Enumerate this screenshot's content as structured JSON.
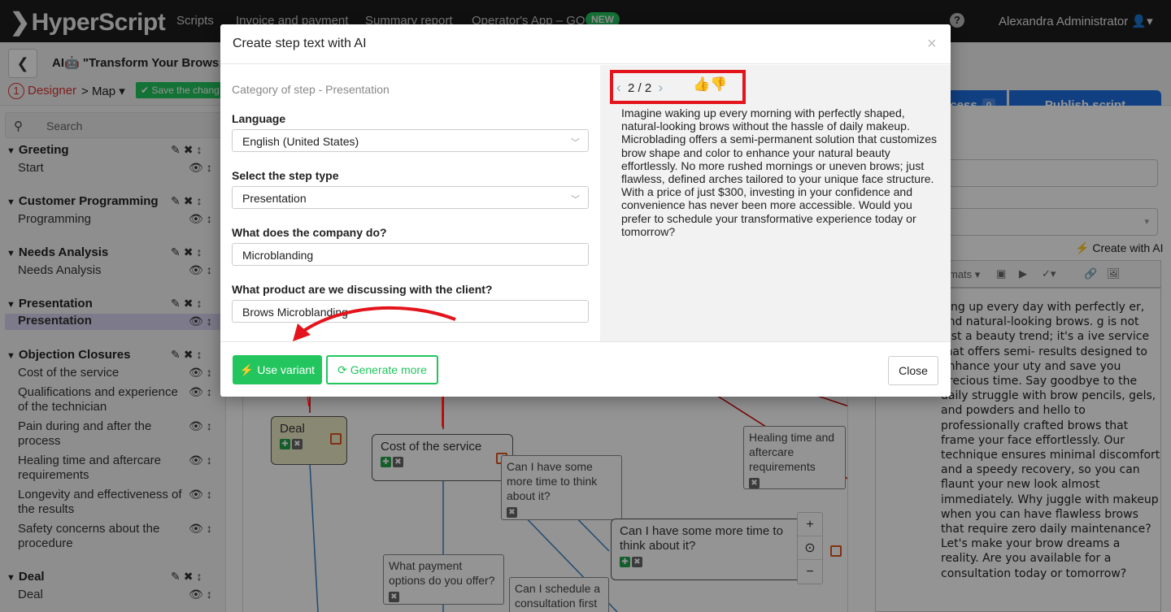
{
  "topbar": {
    "logo": "HyperScript",
    "nav": [
      "Scripts",
      "Invoice and payment",
      "Summary report",
      "Operator's App – GO"
    ],
    "new_badge": "NEW",
    "user": "Alexandra Administrator"
  },
  "subbar": {
    "script_name": "AI🤖 \"Transform Your Brows: D",
    "designer": "Designer",
    "designer_num": "1",
    "map": "Map",
    "save": "Save the chang",
    "access": "ccess",
    "access_count": "0",
    "publish": "Publish script"
  },
  "sidebar": {
    "search_placeholder": "Search",
    "groups": [
      {
        "title": "Greeting",
        "items": [
          "Start"
        ]
      },
      {
        "title": "Customer Programming",
        "items": [
          "Programming"
        ]
      },
      {
        "title": "Needs Analysis",
        "items": [
          "Needs Analysis"
        ]
      },
      {
        "title": "Presentation",
        "items": [
          "Presentation"
        ]
      },
      {
        "title": "Objection Closures",
        "items": [
          "Cost of the service",
          "Qualifications and experience of the technician",
          "Pain during and after the process",
          "Healing time and aftercare requirements",
          "Longevity and effectiveness of the results",
          "Safety concerns about the procedure"
        ]
      },
      {
        "title": "Deal",
        "items": [
          "Deal"
        ]
      }
    ]
  },
  "canvas": {
    "nodes": [
      "Deal",
      "Cost of the service",
      "Can I have some more time to think about it?",
      "Healing time and aftercare requirements",
      "Can I have some more time to think about it?",
      "What payment options do you offer?",
      "Can I schedule a consultation first to"
    ]
  },
  "right": {
    "create_ai": "Create with AI",
    "toolbar_formats": "mats",
    "editor_text": "king up every day with perfectly er, and natural-looking brows. g is not just a beauty trend; it's a ive service that offers semi- results designed to enhance your uty and save you precious time. Say goodbye to the daily struggle with brow pencils, gels, and powders and hello to professionally crafted brows that frame your face effortlessly. Our technique ensures minimal discomfort and a speedy recovery, so you can flaunt your new look almost immediately. Why juggle with makeup when you can have flawless brows that require zero daily maintenance? Let's make your brow dreams a reality. Are you available for a consultation today or tomorrow?"
  },
  "modal": {
    "title": "Create step text with AI",
    "category": "Category of step - Presentation",
    "language_label": "Language",
    "language_value": "English (United States)",
    "steptype_label": "Select the step type",
    "steptype_value": "Presentation",
    "company_label": "What does the company do?",
    "company_value": "Microblanding",
    "product_label": "What product are we discussing with the client?",
    "product_value": "Brows Microblanding",
    "variant_counter": "2 / 2",
    "variant_text": "Imagine waking up every morning with perfectly shaped, natural-looking brows without the hassle of daily makeup. Microblading offers a semi-permanent solution that customizes brow shape and color to enhance your natural beauty effortlessly. No more rushed mornings or uneven brows; just flawless, defined arches tailored to your unique face structure. With a price of just $300, investing in your confidence and convenience has never been more accessible. Would you prefer to schedule your transformative experience today or tomorrow?",
    "use_variant": "Use variant",
    "generate_more": "Generate more",
    "close": "Close"
  },
  "colors": {
    "accent_green": "#22c55e",
    "primary_blue": "#1e6fe0",
    "highlight_red": "#e3141b"
  }
}
